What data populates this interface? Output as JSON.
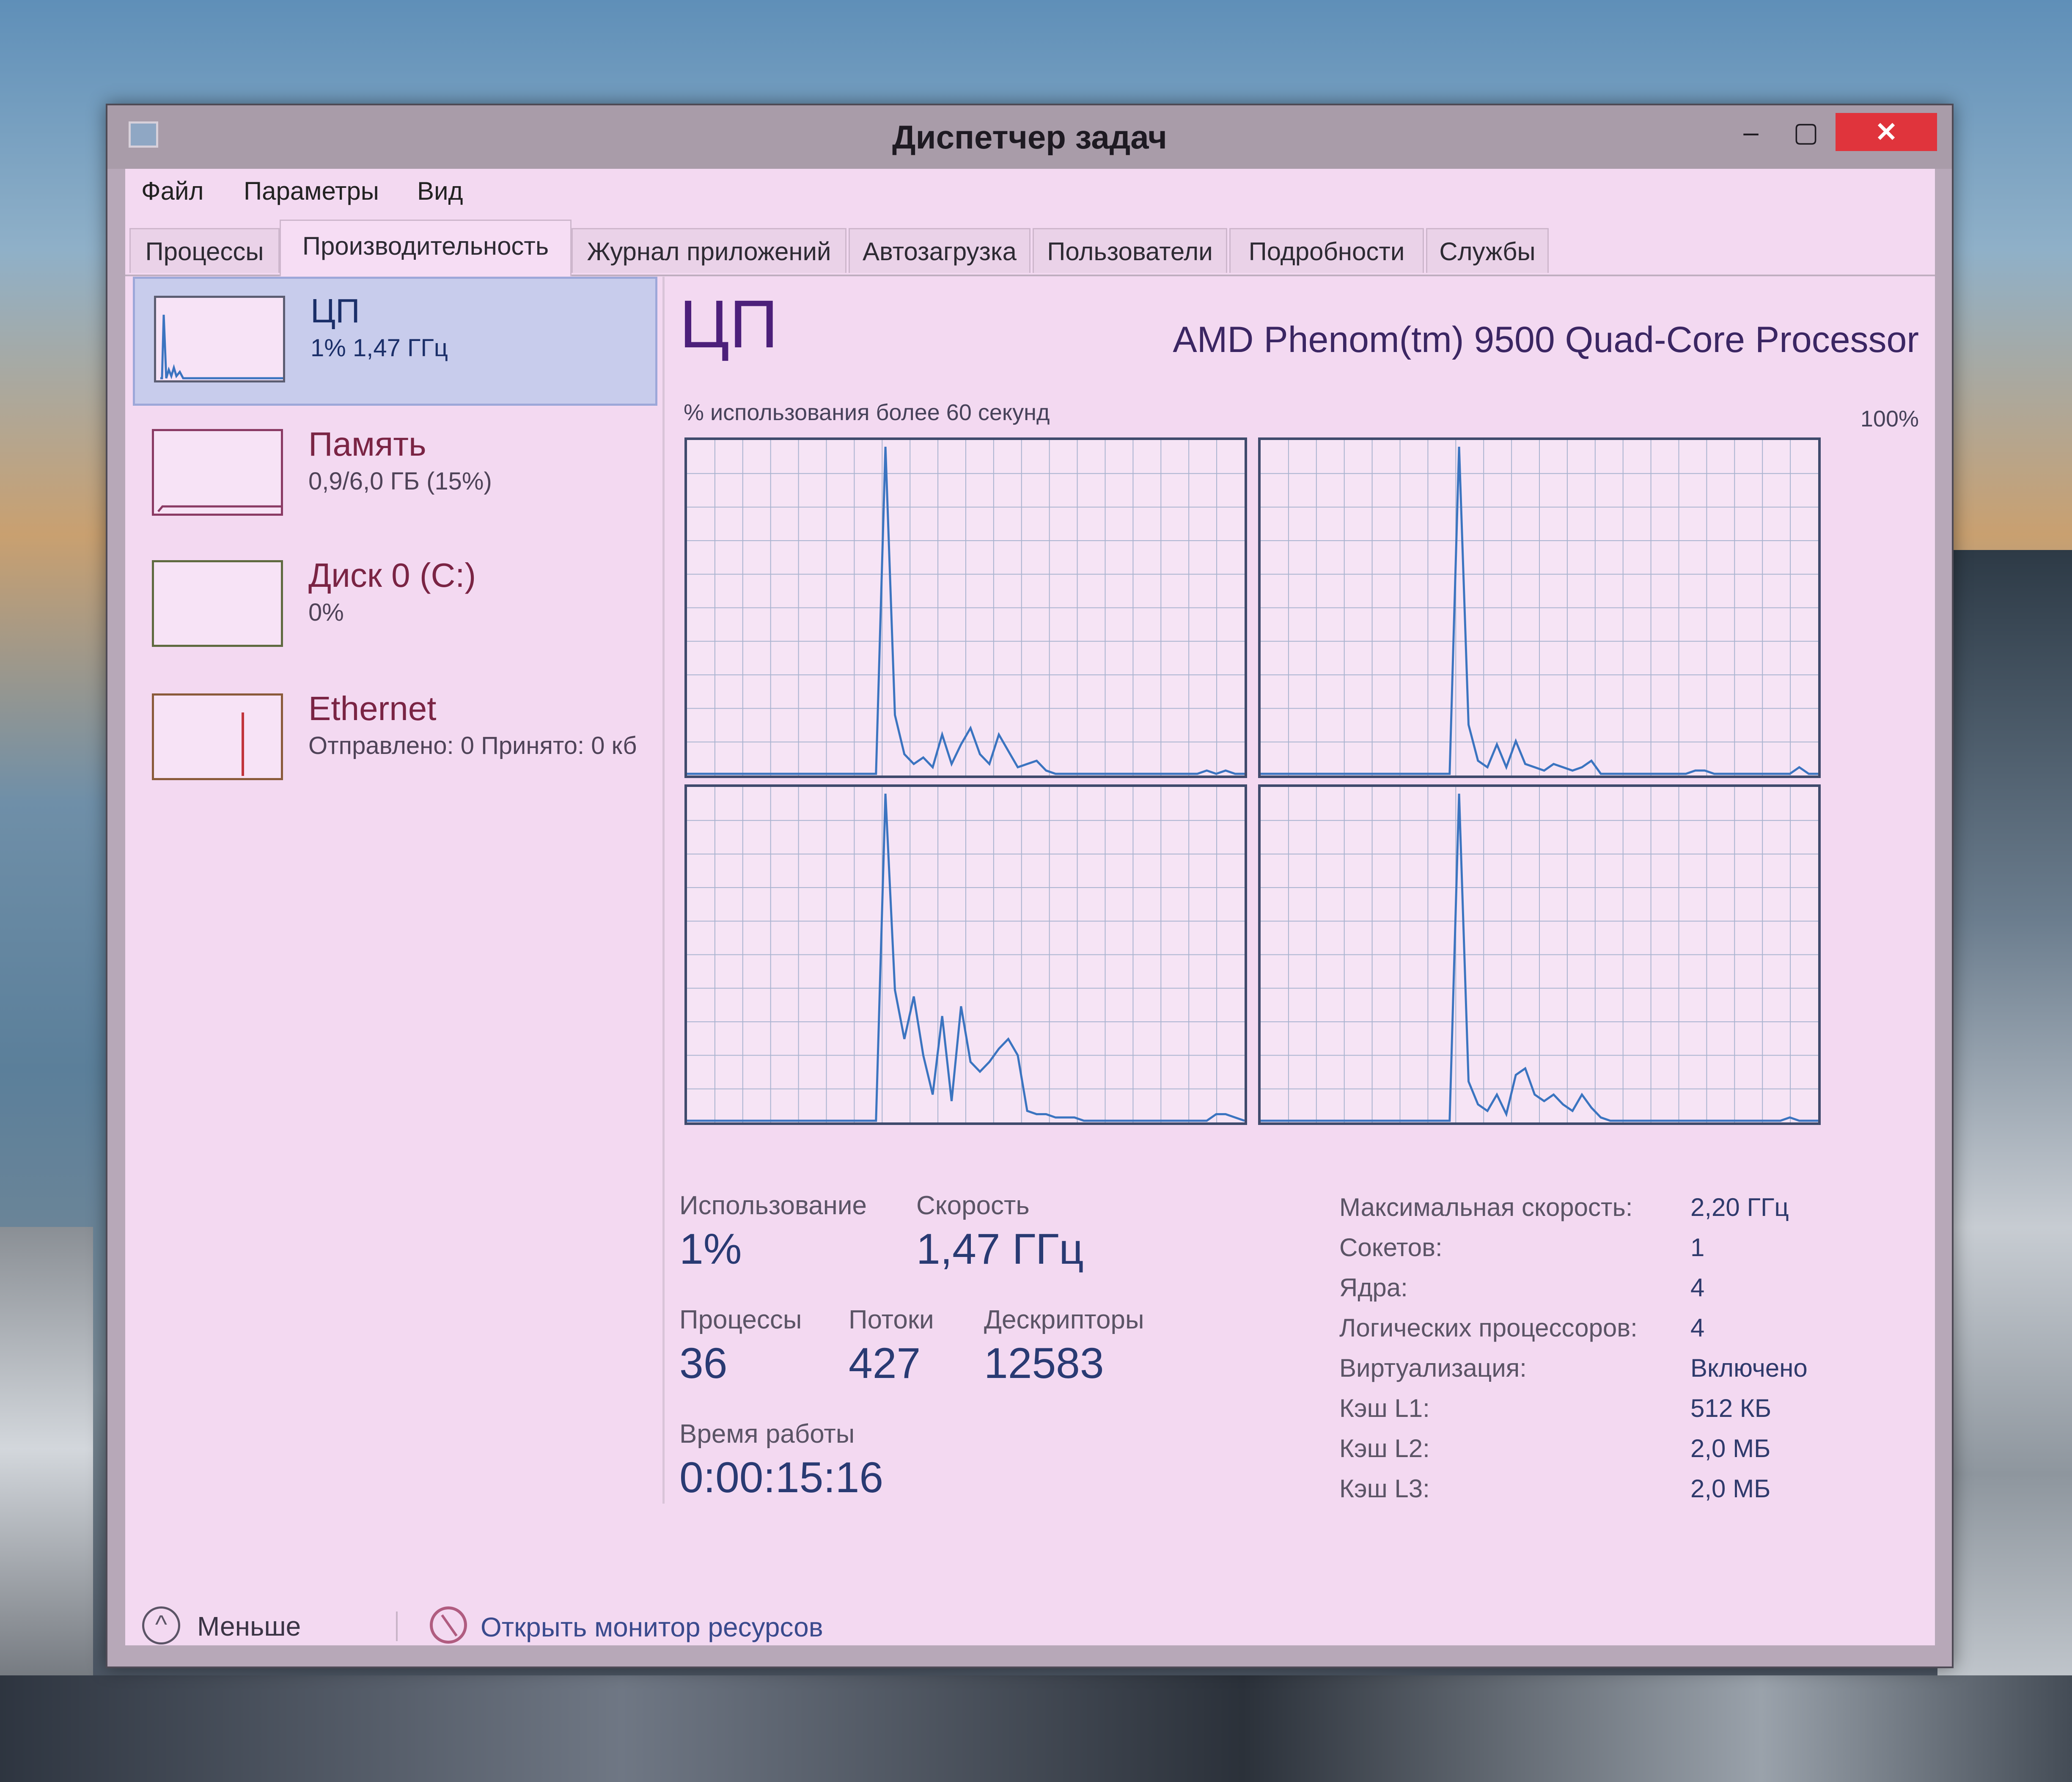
{
  "window": {
    "title": "Диспетчер задач",
    "controls": {
      "minimize": "–",
      "maximize": "▢",
      "close": "✕"
    }
  },
  "menu": [
    "Файл",
    "Параметры",
    "Вид"
  ],
  "tabs": [
    "Процессы",
    "Производительность",
    "Журнал приложений",
    "Автозагрузка",
    "Пользователи",
    "Подробности",
    "Службы"
  ],
  "active_tab": "Производительность",
  "resources": [
    {
      "name": "ЦП",
      "detail": "1% 1,47 ГГц",
      "selected": true
    },
    {
      "name": "Память",
      "detail": "0,9/6,0 ГБ (15%)"
    },
    {
      "name": "Диск 0 (C:)",
      "detail": "0%"
    },
    {
      "name": "Ethernet",
      "detail": "Отправлено: 0 Принято: 0 кб"
    }
  ],
  "cpu": {
    "title": "ЦП",
    "model": "AMD Phenom(tm) 9500 Quad-Core Processor",
    "graph_label": "% использования более 60 секунд",
    "graph_max": "100%",
    "cores": [
      [
        0,
        0,
        0,
        0,
        0,
        0,
        0,
        0,
        0,
        0,
        0,
        0,
        0,
        0,
        0,
        0,
        0,
        0,
        0,
        0,
        0,
        100,
        18,
        6,
        3,
        5,
        2,
        12,
        3,
        9,
        14,
        6,
        3,
        12,
        7,
        2,
        3,
        4,
        1,
        0,
        0,
        0,
        0,
        0,
        0,
        0,
        0,
        0,
        0,
        0,
        0,
        0,
        0,
        0,
        0,
        1,
        0,
        1,
        0,
        0
      ],
      [
        0,
        0,
        0,
        0,
        0,
        0,
        0,
        0,
        0,
        0,
        0,
        0,
        0,
        0,
        0,
        0,
        0,
        0,
        0,
        0,
        0,
        100,
        15,
        4,
        2,
        9,
        2,
        10,
        3,
        2,
        1,
        3,
        2,
        1,
        2,
        4,
        0,
        0,
        0,
        0,
        0,
        0,
        0,
        0,
        0,
        0,
        1,
        1,
        0,
        0,
        0,
        0,
        0,
        0,
        0,
        0,
        0,
        2,
        0,
        0
      ],
      [
        0,
        0,
        0,
        0,
        0,
        0,
        0,
        0,
        0,
        0,
        0,
        0,
        0,
        0,
        0,
        0,
        0,
        0,
        0,
        0,
        0,
        100,
        40,
        25,
        38,
        20,
        8,
        32,
        6,
        35,
        18,
        15,
        18,
        22,
        25,
        20,
        3,
        2,
        2,
        1,
        1,
        1,
        0,
        0,
        0,
        0,
        0,
        0,
        0,
        0,
        0,
        0,
        0,
        0,
        0,
        0,
        2,
        2,
        1,
        0
      ],
      [
        0,
        0,
        0,
        0,
        0,
        0,
        0,
        0,
        0,
        0,
        0,
        0,
        0,
        0,
        0,
        0,
        0,
        0,
        0,
        0,
        0,
        100,
        12,
        5,
        3,
        8,
        2,
        14,
        16,
        8,
        6,
        8,
        5,
        3,
        8,
        4,
        1,
        0,
        0,
        0,
        0,
        0,
        0,
        0,
        0,
        0,
        0,
        0,
        0,
        0,
        0,
        0,
        0,
        0,
        0,
        0,
        1,
        0,
        0,
        0
      ]
    ],
    "stats": {
      "usage_label": "Использование",
      "usage_value": "1%",
      "speed_label": "Скорость",
      "speed_value": "1,47 ГГц",
      "processes_label": "Процессы",
      "processes_value": "36",
      "threads_label": "Потоки",
      "threads_value": "427",
      "handles_label": "Дескрипторы",
      "handles_value": "12583",
      "uptime_label": "Время работы",
      "uptime_value": "0:00:15:16"
    },
    "specs": [
      {
        "label": "Максимальная скорость:",
        "value": "2,20 ГГц"
      },
      {
        "label": "Сокетов:",
        "value": "1"
      },
      {
        "label": "Ядра:",
        "value": "4"
      },
      {
        "label": "Логических процессоров:",
        "value": "4"
      },
      {
        "label": "Виртуализация:",
        "value": "Включено"
      },
      {
        "label": "Кэш L1:",
        "value": "512 КБ"
      },
      {
        "label": "Кэш L2:",
        "value": "2,0 МБ"
      },
      {
        "label": "Кэш L3:",
        "value": "2,0 МБ"
      }
    ]
  },
  "footer": {
    "less": "Меньше",
    "monitor_link": "Открыть монитор ресурсов"
  },
  "colors": {
    "graph_line": "#3b74c0",
    "grid": "#a9b3cf",
    "close_button": "#e0343c"
  }
}
